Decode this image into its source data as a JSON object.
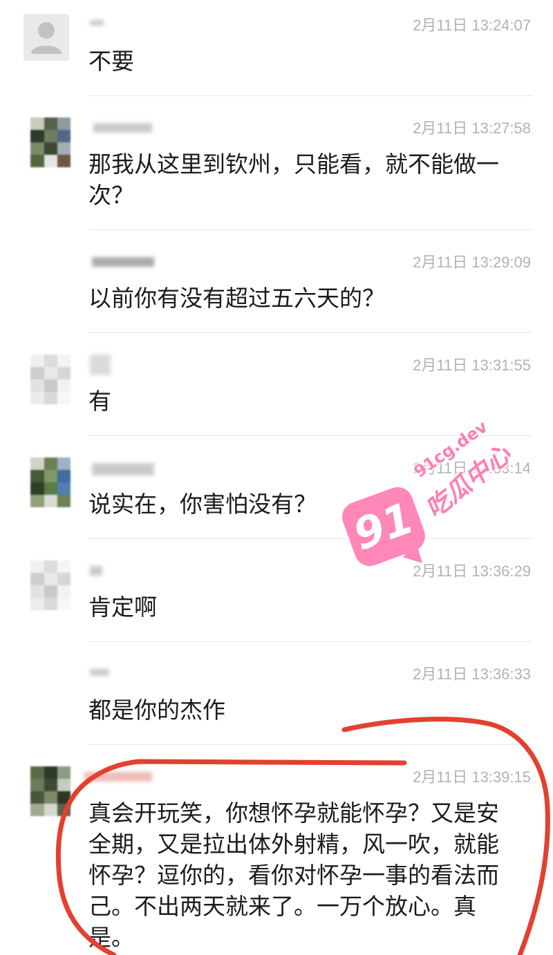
{
  "messages": [
    {
      "time": "2月11日 13:24:07",
      "text": "不要"
    },
    {
      "time": "2月11日 13:27:58",
      "text": "那我从这里到钦州，只能看，就不能做一次？"
    },
    {
      "time": "2月11日 13:29:09",
      "text": "以前你有没有超过五六天的？"
    },
    {
      "time": "2月11日 13:31:55",
      "text": "有"
    },
    {
      "time": "2月11日 13:33:14",
      "text": "说实在，你害怕没有？"
    },
    {
      "time": "2月11日 13:36:29",
      "text": "肯定啊"
    },
    {
      "time": "2月11日 13:36:33",
      "text": "都是你的杰作"
    },
    {
      "time": "2月11日 13:39:15",
      "text": "真会开玩笑，你想怀孕就能怀孕？又是安全期，又是拉出体外射精，风一吹，就能怀孕？逗你的，看你对怀孕一事的看法而己。不出两天就来了。一万个放心。真是。"
    }
  ],
  "watermark": {
    "badge_text": "91",
    "domain": "91cg.dev",
    "name": "吃瓜中心"
  },
  "colors": {
    "text": "#1b1b1b",
    "timestamp": "#b2b2b2",
    "divider": "#e6e6e6",
    "annotation": "#e4402f",
    "watermark": "#ff7eb3"
  }
}
